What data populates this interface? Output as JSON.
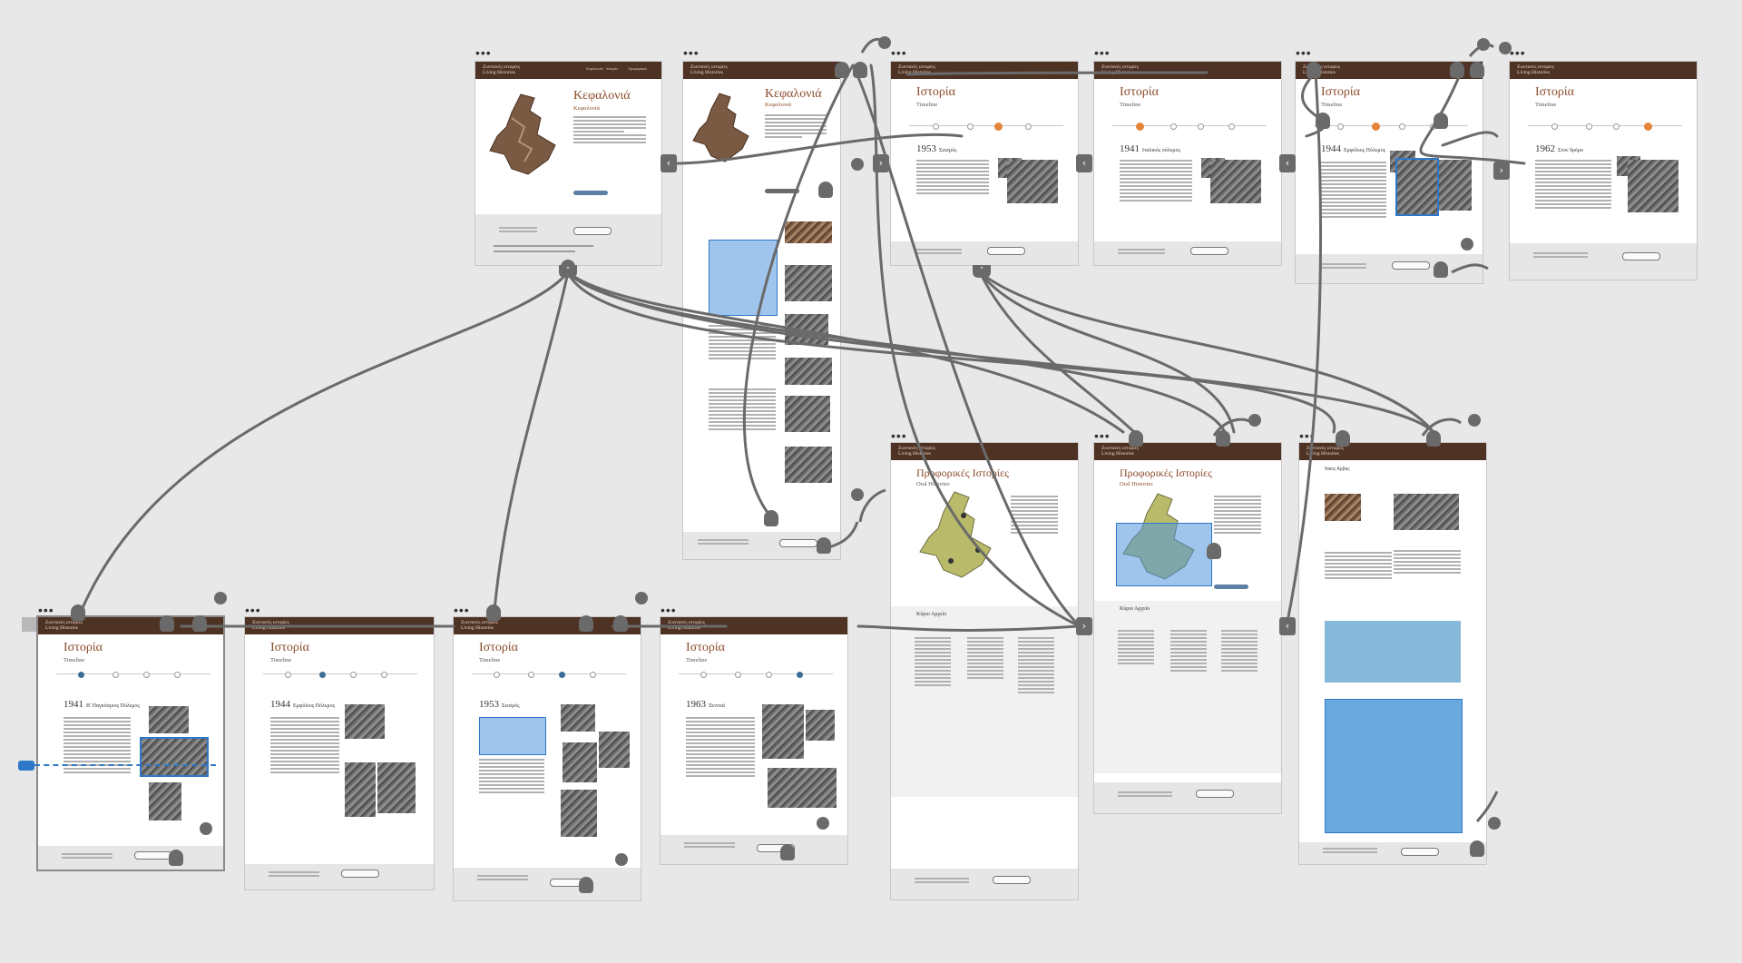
{
  "site_name": "Ζωντανές ιστορίες",
  "site_name_en": "Living Histories",
  "nav": [
    "Αρχική",
    "Κεφαλονιά",
    "Ιστορία",
    "Προφορικές"
  ],
  "artboards": {
    "kefalonia_1": {
      "title": "Κεφαλονιά",
      "subtitle": "Κεφαλονιά"
    },
    "kefalonia_2": {
      "title": "Κεφαλονιά",
      "subtitle": "Κεφαλονιά"
    },
    "timeline_1953_top": {
      "title": "Ιστορία",
      "subtitle": "Timeline",
      "year": "1953",
      "year_label": "Σεισμός"
    },
    "timeline_1941_top": {
      "title": "Ιστορία",
      "subtitle": "Timeline",
      "year": "1941",
      "year_label": "Ιταλικός πόλεμος"
    },
    "timeline_1944_top": {
      "title": "Ιστορία",
      "subtitle": "Timeline",
      "year": "1944",
      "year_label": "Εμφύλιος Πόλεμος"
    },
    "timeline_1962_top": {
      "title": "Ιστορία",
      "subtitle": "Timeline",
      "year": "1962",
      "year_label": "Στον δρόμο"
    },
    "oral_1": {
      "title": "Προφορικές Ιστορίες",
      "subtitle": "Oral Histories",
      "archive": "Κύριο Αρχείο"
    },
    "oral_2": {
      "title": "Προφορικές Ιστορίες",
      "subtitle": "Oral Histories",
      "archive": "Κύριο Αρχείο"
    },
    "oral_detail": {
      "title": "Νικος Αρβας"
    },
    "timeline_1941": {
      "title": "Ιστορία",
      "subtitle": "Timeline",
      "year": "1941",
      "year_label": "Β' Παγκόσμιος Πόλεμος"
    },
    "timeline_1944": {
      "title": "Ιστορία",
      "subtitle": "Timeline",
      "year": "1944",
      "year_label": "Εμφύλιος Πόλεμος"
    },
    "timeline_1953": {
      "title": "Ιστορία",
      "subtitle": "Timeline",
      "year": "1953",
      "year_label": "Σεισμός"
    },
    "timeline_1963": {
      "title": "Ιστορία",
      "subtitle": "Timeline",
      "year": "1963",
      "year_label": "Ξενιτιά"
    }
  },
  "icons": {
    "prev": "chevron-left-icon",
    "next": "chevron-right-icon",
    "up": "chevron-up-icon",
    "more": "more-icon"
  },
  "glyphs": {
    "prev": "‹",
    "next": "›",
    "up": "˄",
    "more": "•••"
  },
  "colors": {
    "canvas": "#e8e8e8",
    "header": "#4e3224",
    "title": "#8b4a2a",
    "selection": "#2f78c9",
    "connector": "#6a6a6a",
    "timeline_active": "#3c6d97",
    "timeline_orange": "#e68439"
  }
}
